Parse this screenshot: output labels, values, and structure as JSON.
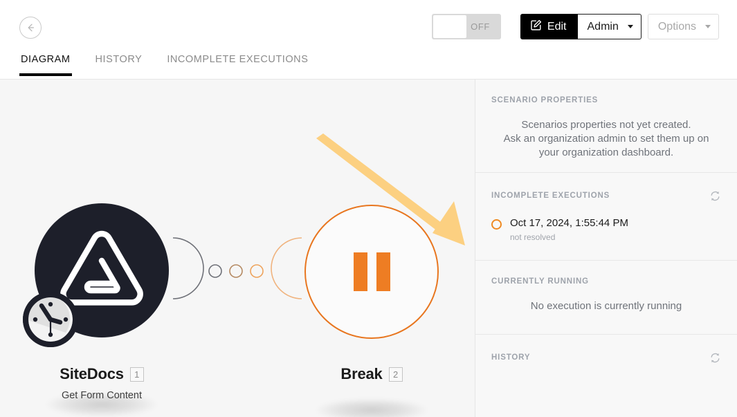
{
  "header": {
    "back_button": "back-arrow",
    "toggle": {
      "state_label": "OFF",
      "is_on": false
    },
    "buttons": {
      "edit": "Edit",
      "admin": "Admin",
      "options": "Options"
    },
    "tabs": [
      {
        "label": "DIAGRAM",
        "active": true
      },
      {
        "label": "HISTORY",
        "active": false
      },
      {
        "label": "INCOMPLETE EXECUTIONS",
        "active": false
      }
    ]
  },
  "canvas": {
    "modules": [
      {
        "title": "SiteDocs",
        "badge": "1",
        "subtitle": "Get Form Content",
        "icon": "sitedocs-logo",
        "has_clock_badge": true
      },
      {
        "title": "Break",
        "badge": "2",
        "subtitle": "",
        "icon": "pause-icon",
        "has_clock_badge": false
      }
    ],
    "annotation_arrow": "orange-arrow-pointing-to-break-module",
    "colors": {
      "module_dark": "#1d1f2a",
      "accent_orange": "#ee7d23",
      "annotation": "#fcd081",
      "canvas_bg": "#f6f6f6"
    }
  },
  "sidebar": {
    "scenario_properties": {
      "title": "SCENARIO PROPERTIES",
      "empty_line1": "Scenarios properties not yet created.",
      "empty_line2": "Ask an organization admin to set them up on your organization dashboard."
    },
    "incomplete_executions": {
      "title": "INCOMPLETE EXECUTIONS",
      "refresh": "refresh-icon",
      "items": [
        {
          "date": "Oct 17, 2024, 1:55:44 PM",
          "status": "not resolved"
        }
      ]
    },
    "currently_running": {
      "title": "CURRENTLY RUNNING",
      "empty": "No execution is currently running"
    },
    "history": {
      "title": "HISTORY",
      "refresh": "refresh-icon"
    }
  }
}
